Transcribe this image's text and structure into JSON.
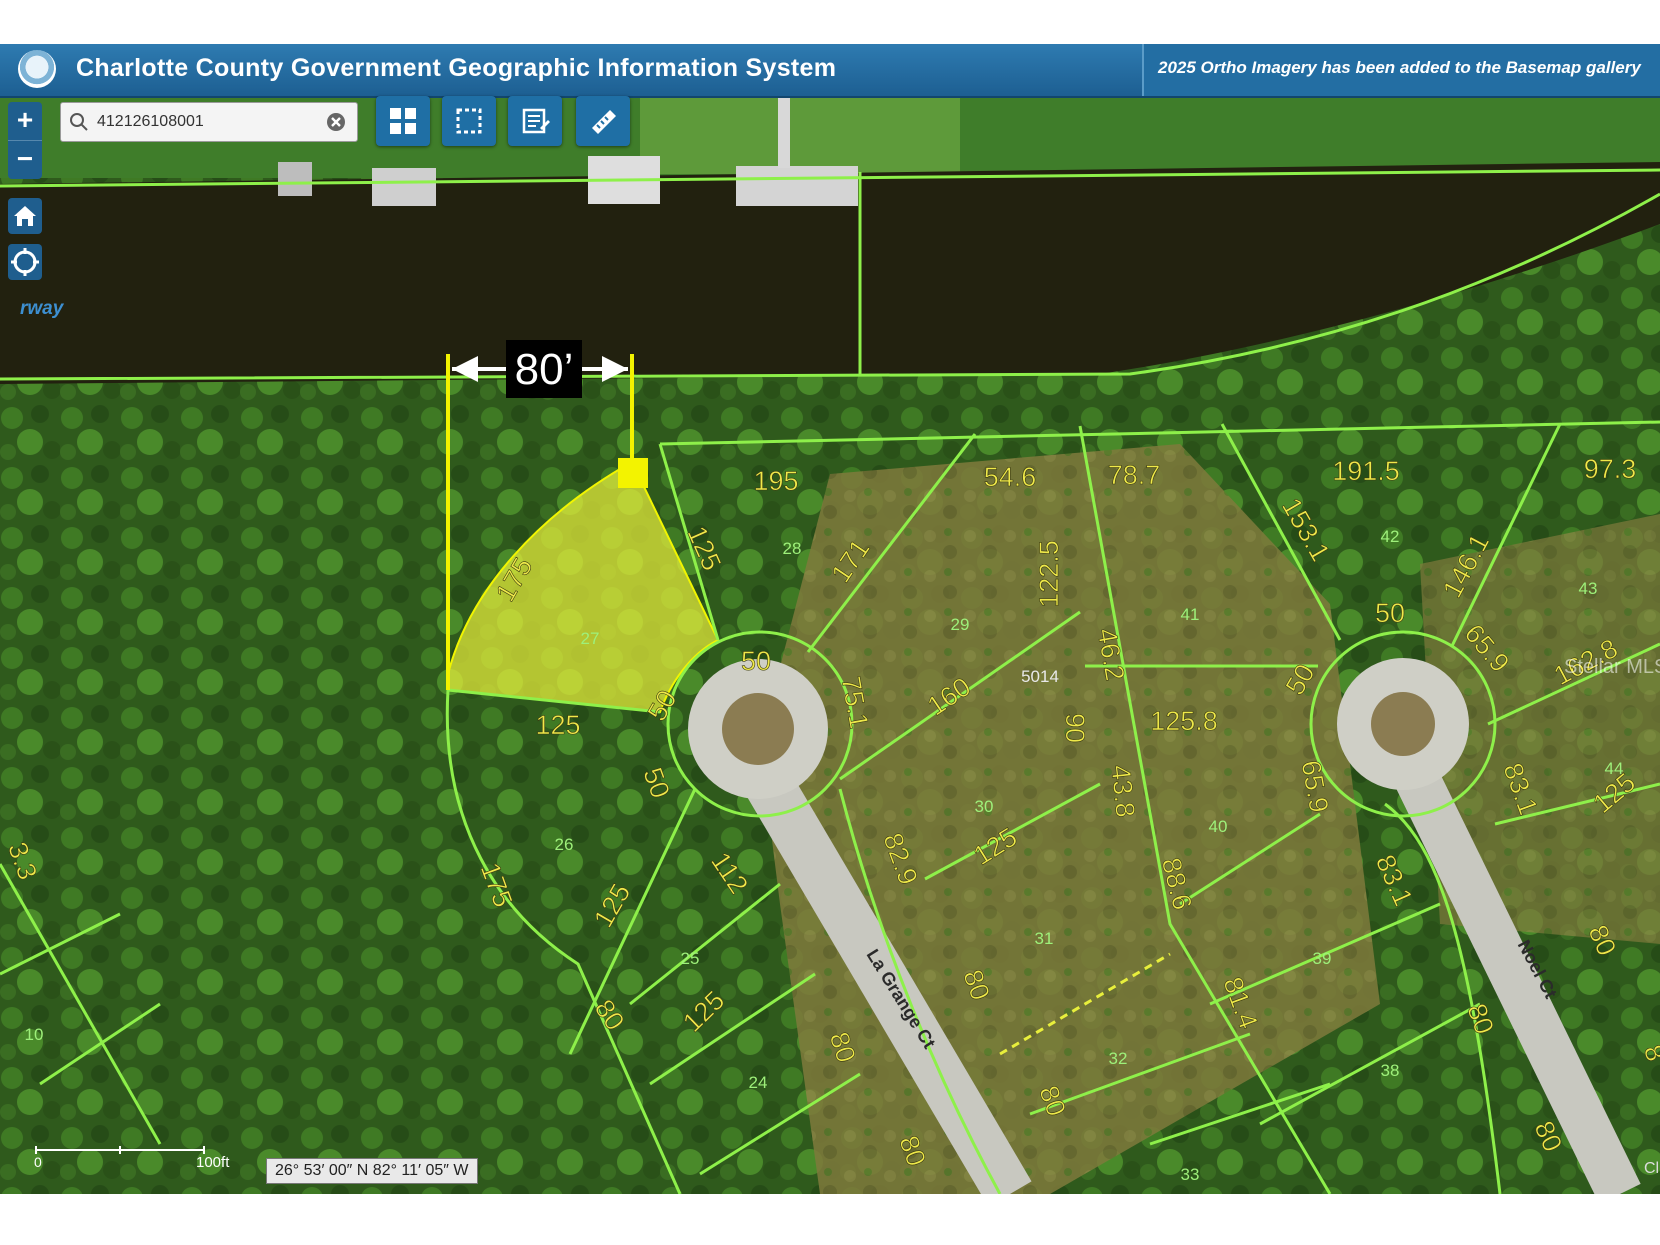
{
  "app": {
    "title": "Charlotte County Government Geographic Information System",
    "notice": "2025 Ortho Imagery has been added to the Basemap gallery"
  },
  "search": {
    "value": "412126108001"
  },
  "map_controls": {
    "zoom_in": "+",
    "zoom_out": "−",
    "home_icon": "home-icon",
    "locate_icon": "locate-icon"
  },
  "toolbar": {
    "icons": [
      "basemap-gallery-icon",
      "select-area-icon",
      "print-map-icon",
      "measure-ruler-icon"
    ]
  },
  "labels": {
    "waterway_fragment": "rway",
    "watermark": "Stellar MLS",
    "corner_fragment": "Cl"
  },
  "annotation": {
    "measure": "80’"
  },
  "streets": {
    "la_grange": "La Grange Ct",
    "noel": "Noel Ct"
  },
  "lot_numbers": [
    "10",
    "24",
    "25",
    "26",
    "27",
    "28",
    "29",
    "30",
    "31",
    "32",
    "33",
    "38",
    "39",
    "40",
    "41",
    "42",
    "43",
    "44",
    "5014"
  ],
  "dimensions": {
    "d195": "195",
    "d546": "54.6",
    "d787": "78.7",
    "d1915": "191.5",
    "d973": "97.3",
    "d175a": "175",
    "d125a": "125",
    "d125b": "125",
    "d50a": "50",
    "d50b": "50",
    "d50c": "50",
    "d171": "171",
    "d1225": "122.5",
    "d1531": "153.1",
    "d1461": "146.1",
    "d751": "75.1",
    "d160": "160",
    "d90": "90",
    "d462": "46.2",
    "d1258": "125.8",
    "d50d": "50",
    "d50e": "50",
    "d659a": "65.9",
    "d1628": "162.8",
    "d50f": "50",
    "d175b": "175",
    "d125c": "125",
    "d112": "112",
    "d829": "82.9",
    "d125d": "125",
    "d438": "43.8",
    "d886": "88.6",
    "d659b": "65.9",
    "d831a": "83.1",
    "d125e": "125",
    "d831b": "83.1",
    "d80a": "80",
    "d125f": "125",
    "d80b": "80",
    "d80c": "80",
    "d80d": "80",
    "d814": "81.4",
    "d80e": "80",
    "d80f": "80",
    "d80g": "80",
    "d80h": "80",
    "d80i": "80",
    "d33": "3.3",
    "d8": "8"
  },
  "status": {
    "coordinates": "26° 53′ 00″ N 82° 11′ 05″ W",
    "scale_label": "100ft",
    "scale_zero": "0"
  }
}
